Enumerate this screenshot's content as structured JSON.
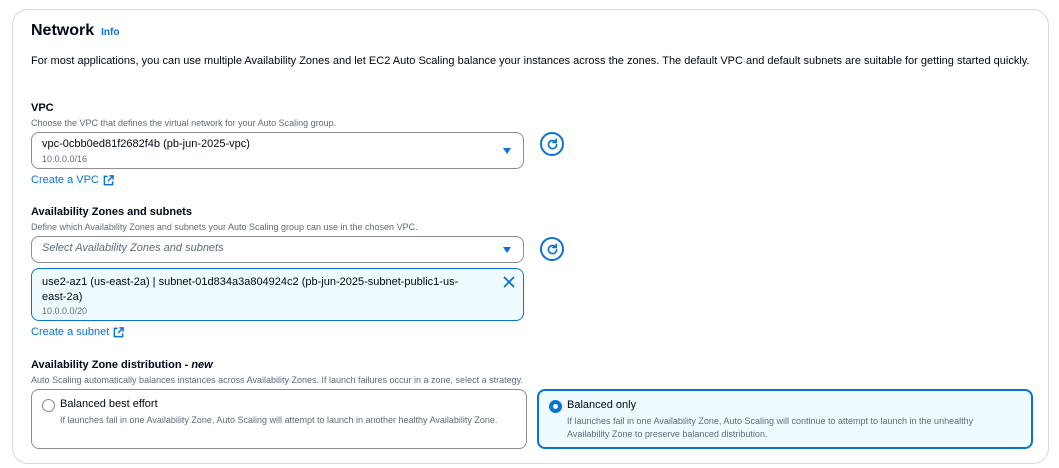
{
  "network": {
    "title": "Network",
    "info_link": "Info",
    "description": "For most applications, you can use multiple Availability Zones and let EC2 Auto Scaling balance your instances across the zones. The default VPC and default subnets are suitable for getting started quickly."
  },
  "vpc": {
    "label": "VPC",
    "description": "Choose the VPC that defines the virtual network for your Auto Scaling group.",
    "selected_value": "vpc-0cbb0ed81f2682f4b (pb-jun-2025-vpc)",
    "selected_cidr": "10.0.0.0/16",
    "create_link": "Create a VPC"
  },
  "az_subnets": {
    "label": "Availability Zones and subnets",
    "description": "Define which Availability Zones and subnets your Auto Scaling group can use in the chosen VPC.",
    "placeholder": "Select Availability Zones and subnets",
    "token_text": "use2-az1 (us-east-2a) | subnet-01d834a3a804924c2 (pb-jun-2025-subnet-public1-us-east-2a)",
    "token_cidr": "10.0.0.0/20",
    "create_link": "Create a subnet"
  },
  "distribution": {
    "label": "Availability Zone distribution - ",
    "label_new": "new",
    "description": "Auto Scaling automatically balances instances across Availability Zones. If launch failures occur in a zone, select a strategy.",
    "options": [
      {
        "label": "Balanced best effort",
        "description": "If launches fail in one Availability Zone, Auto Scaling will attempt to launch in another healthy Availability Zone.",
        "selected": false
      },
      {
        "label": "Balanced only",
        "description": "If launches fail in one Availability Zone, Auto Scaling will continue to attempt to launch in the unhealthy Availability Zone to preserve balanced distribution.",
        "selected": true
      }
    ]
  },
  "icons": {
    "refresh": "refresh-icon",
    "caret": "caret-down-icon",
    "external": "external-link-icon",
    "close": "close-icon"
  },
  "colors": {
    "accent": "#0972d3",
    "border": "#8c8c94",
    "selected_bg": "#f0fbff",
    "text": "#000716",
    "secondary_text": "#5f6b7a"
  }
}
